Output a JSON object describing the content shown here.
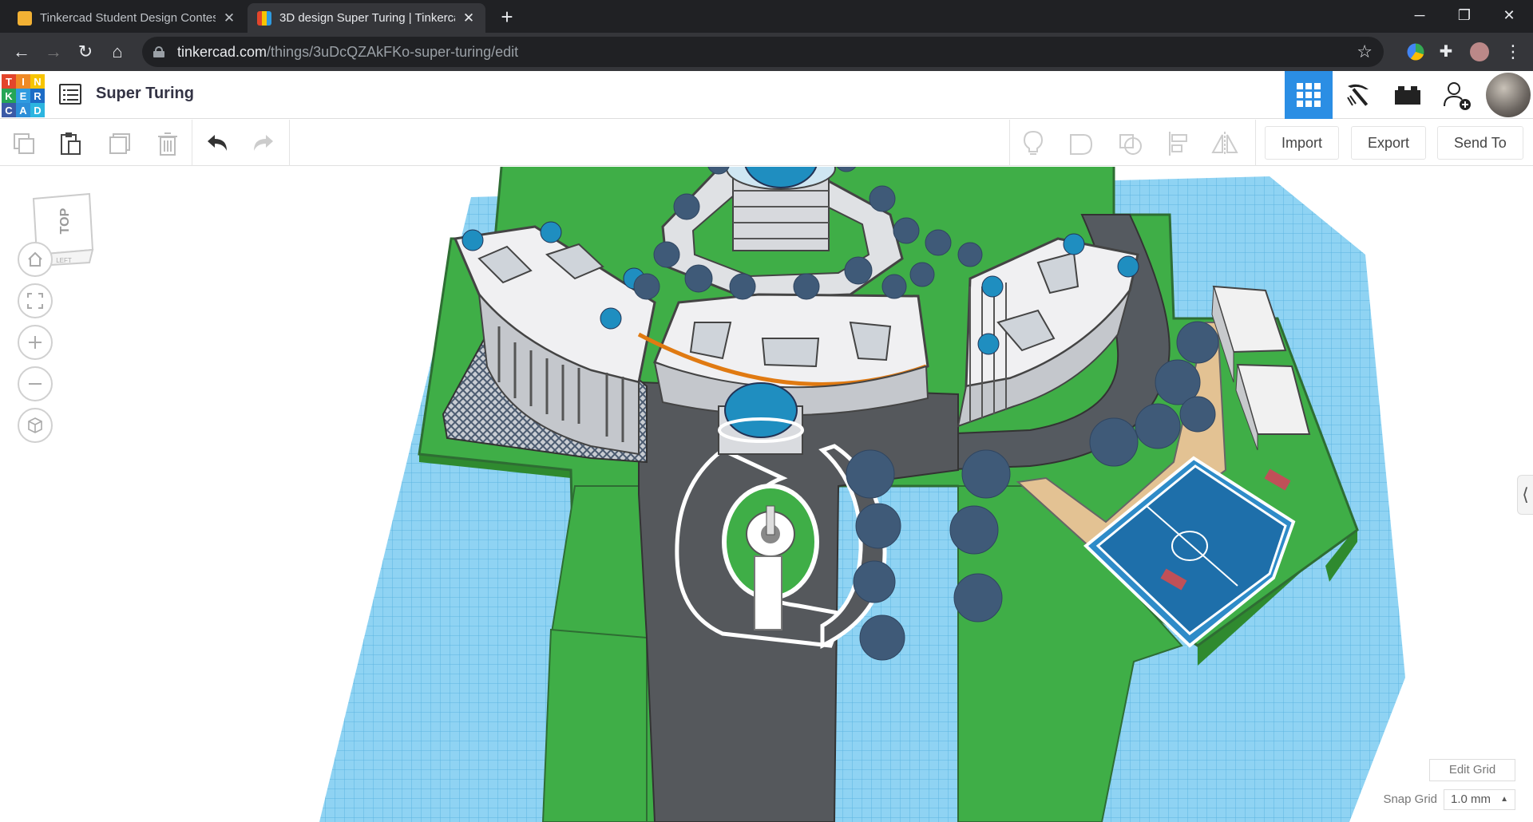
{
  "browser": {
    "tabs": [
      {
        "title": "Tinkercad Student Design Contes",
        "active": false
      },
      {
        "title": "3D design Super Turing | Tinkerca",
        "active": true
      }
    ],
    "new_tab": "+",
    "url_host": "tinkercad.com",
    "url_path": "/things/3uDcQZAkFKo-super-turing/edit"
  },
  "app": {
    "logo_letters": [
      "T",
      "I",
      "N",
      "K",
      "E",
      "R",
      "C",
      "A",
      "D"
    ],
    "logo_colors": [
      "#e3452b",
      "#ef8a26",
      "#f7c400",
      "#26a657",
      "#2f9be0",
      "#1d6cc6",
      "#3b5aa6",
      "#2c8ed8",
      "#2cb5e0"
    ],
    "design_title": "Super Turing",
    "accent": "#2b8ee4"
  },
  "toolbar": {
    "import_label": "Import",
    "export_label": "Export",
    "send_to_label": "Send To"
  },
  "viewcube": {
    "top_label": "TOP",
    "front_label": "LEFT"
  },
  "grid": {
    "edit_grid_label": "Edit Grid",
    "snap_grid_label": "Snap Grid",
    "snap_grid_value": "1.0 mm"
  }
}
